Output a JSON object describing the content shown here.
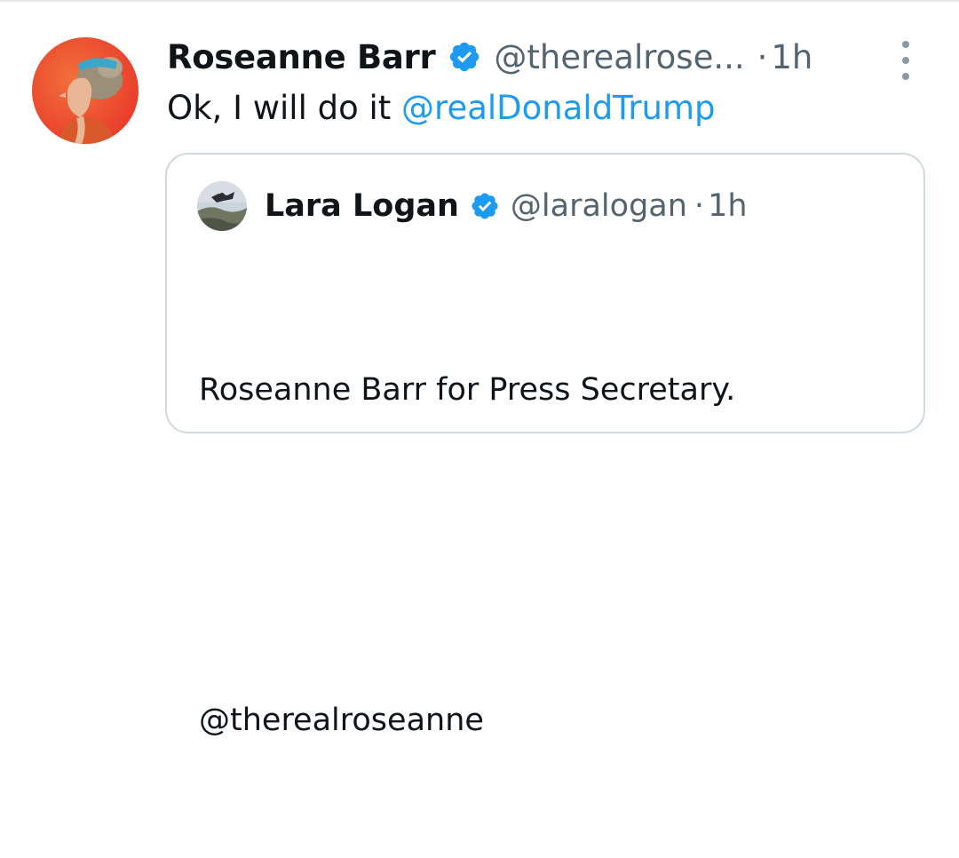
{
  "tweet": {
    "author_name": "Roseanne Barr",
    "author_handle": "@therealrose...",
    "separator": "·",
    "time": "1h",
    "text_prefix": "Ok, I will do it ",
    "text_mention": "@realDonaldTrump",
    "verified_icon": "verified-badge-icon",
    "menu_icon": "more-vertical-icon"
  },
  "quote": {
    "author_name": "Lara Logan",
    "author_handle": "@laralogan",
    "separator": "·",
    "time": "1h",
    "line1": "Roseanne Barr for Press Secretary.",
    "line2": "",
    "line3": "@therealroseanne",
    "verified_icon": "verified-badge-icon"
  },
  "colors": {
    "accent": "#1d9bf0",
    "muted_text": "#536471",
    "border": "#cfd9de"
  }
}
